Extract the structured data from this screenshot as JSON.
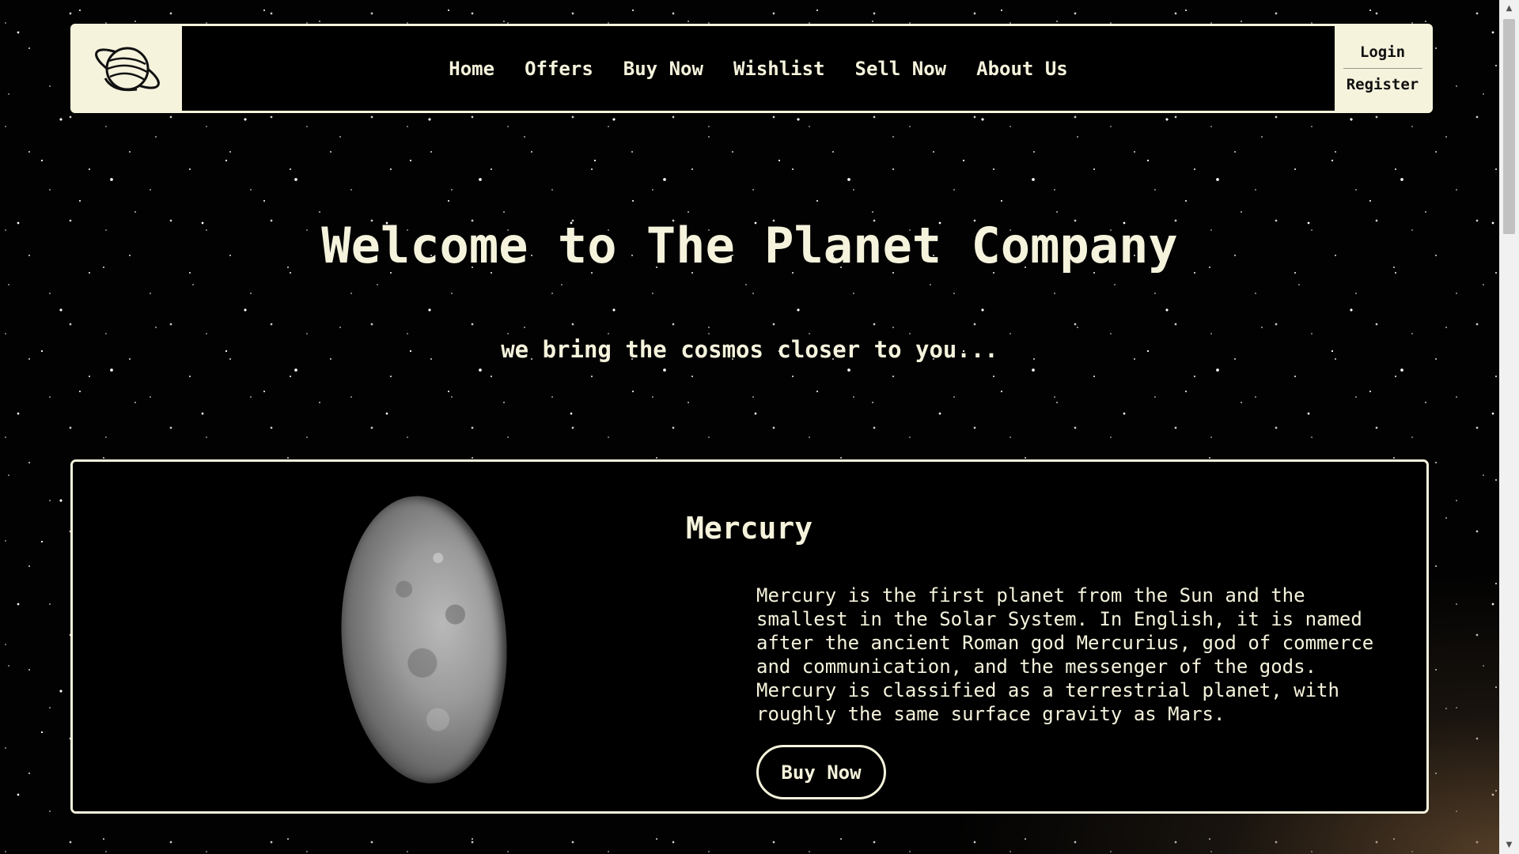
{
  "header": {
    "logo_icon": "planet-logo-icon",
    "nav_items": [
      {
        "label": "Home"
      },
      {
        "label": "Offers"
      },
      {
        "label": "Buy Now"
      },
      {
        "label": "Wishlist"
      },
      {
        "label": "Sell Now"
      },
      {
        "label": "About Us"
      }
    ],
    "auth": {
      "login_label": "Login",
      "register_label": "Register"
    }
  },
  "hero": {
    "title": "Welcome to The Planet Company",
    "subtitle": "we bring the cosmos closer to you..."
  },
  "product": {
    "name": "Mercury",
    "description": "Mercury is the first planet from the Sun and the smallest in the Solar System. In English, it is named after the ancient Roman god Mercurius, god of commerce and communication, and the messenger of the gods. Mercury is classified as a terrestrial planet, with roughly the same surface gravity as Mars.",
    "buy_label": "Buy Now",
    "image_icon": "mercury-planet-image"
  },
  "colors": {
    "accent": "#f5f3dc",
    "background": "#000000"
  }
}
